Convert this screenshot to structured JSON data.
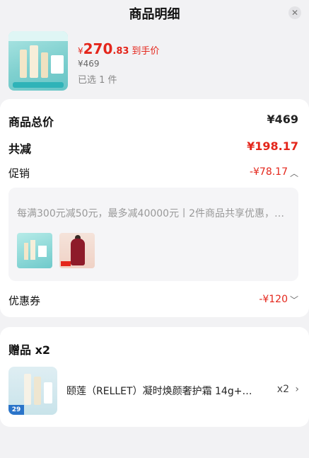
{
  "header": {
    "title": "商品明细",
    "close_icon": "close-icon"
  },
  "product": {
    "price_symbol": "¥",
    "price_integer": "270",
    "price_decimal": ".83",
    "price_tag": "到手价",
    "original_price": "¥469",
    "selected_count": "已选 1 件"
  },
  "summary": {
    "total_label": "商品总价",
    "total_value": "¥469",
    "discount_label": "共减",
    "discount_value": "¥198.17",
    "promo_label": "促销",
    "promo_value": "-¥78.17",
    "promo_text": "每满300元减50元，最多减40000元丨2件商品共享优惠，…",
    "coupon_label": "优惠券",
    "coupon_value": "-¥120"
  },
  "gift": {
    "title": "赠品 x2",
    "name": "颐莲（RELLET）凝时焕颜奢护霜 14g+…",
    "qty": "x2",
    "badge": "29"
  },
  "colors": {
    "accent_red": "#e4261b",
    "background": "#f2f2f4",
    "card": "#ffffff"
  }
}
